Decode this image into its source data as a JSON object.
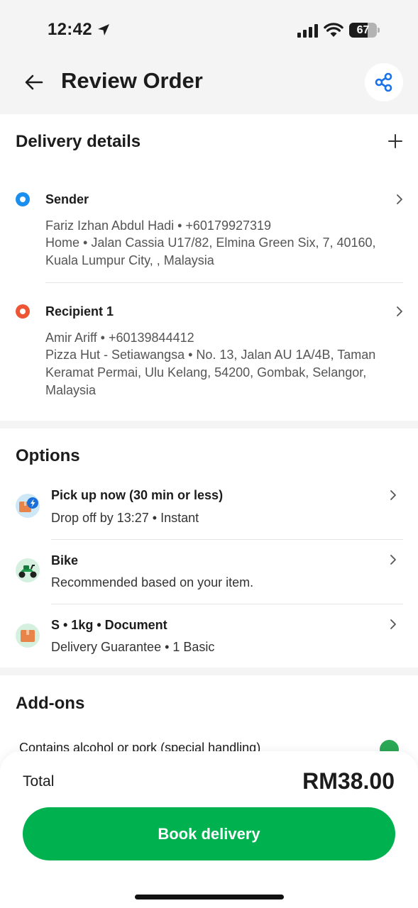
{
  "status_bar": {
    "time": "12:42",
    "battery": "67",
    "battery_level": 0.67
  },
  "header": {
    "title": "Review Order"
  },
  "delivery": {
    "title": "Delivery details",
    "sender": {
      "label": "Sender",
      "line1": "Fariz Izhan Abdul Hadi • +60179927319",
      "line2": "Home • Jalan Cassia U17/82, Elmina Green Six, 7, 40160,",
      "line3": "Kuala Lumpur City, , Malaysia"
    },
    "recipient": {
      "label": "Recipient 1",
      "line1": "Amir Ariff • +60139844412",
      "line2": "Pizza Hut - Setiawangsa • No. 13, Jalan AU 1A/4B, Taman",
      "line3": "Keramat Permai, Ulu Kelang, 54200, Gombak, Selangor,",
      "line4": "Malaysia"
    }
  },
  "options": {
    "title": "Options",
    "items": [
      {
        "title": "Pick up now (30 min or less)",
        "subtitle": "Drop off by 13:27 • Instant"
      },
      {
        "title": "Bike",
        "subtitle": "Recommended based on your item."
      },
      {
        "title": "S • 1kg • Document",
        "subtitle": "Delivery Guarantee • 1 Basic"
      }
    ]
  },
  "addons": {
    "title": "Add-ons",
    "item": "Contains alcohol or pork (special handling)"
  },
  "footer": {
    "total_label": "Total",
    "total_value": "RM38.00",
    "book_label": "Book delivery"
  },
  "colors": {
    "brand_green": "#00b14f",
    "sender_blue": "#1a8ff0",
    "recipient_red": "#ee5535",
    "share_blue": "#1a73e8"
  },
  "icons": [
    "back-arrow-icon",
    "share-icon",
    "plus-icon",
    "chevron-right-icon",
    "instant-parcel-icon",
    "bike-icon",
    "package-icon",
    "add-circle-icon"
  ]
}
